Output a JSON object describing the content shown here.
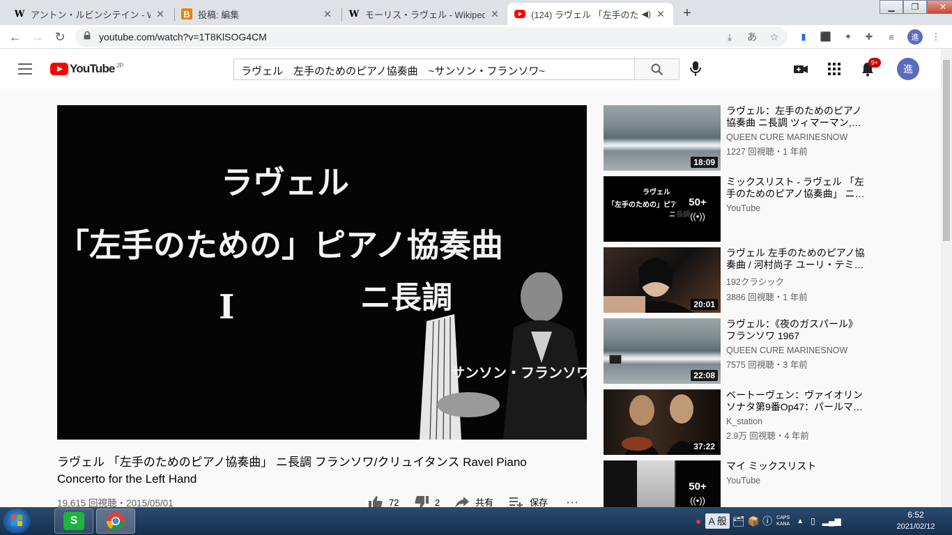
{
  "browser": {
    "tabs": [
      {
        "title": "アントン・ルビンシテイン - Wi",
        "favicon": "W"
      },
      {
        "title": "投稿: 編集",
        "favicon": "B"
      },
      {
        "title": "モーリス・ラヴェル - Wikipedi",
        "favicon": "W"
      },
      {
        "title": "(124) ラヴェル 「左手のた",
        "favicon": "youtube-icon",
        "active": true
      }
    ],
    "url": "youtube.com/watch?v=1T8KlSOG4CM"
  },
  "youtube": {
    "logo_text": "YouTube",
    "region": "JP",
    "search_query": "ラヴェル　左手のためのピアノ協奏曲　~サンソン・フランソワ~",
    "notification_count": "9+",
    "avatar_initial": "進"
  },
  "player_overlay": {
    "line1": "ラヴェル",
    "line2": "「左手のための」ピアノ協奏曲",
    "roman": "I",
    "key": "ニ長調",
    "performer": "サンソン・フランソワ"
  },
  "video": {
    "title": "ラヴェル 「左手のためのピアノ協奏曲」 ニ長調 フランソワ/クリュイタンス Ravel Piano Concerto for the Left Hand",
    "views_date": "19,615 回視聴・2015/05/01",
    "likes": "72",
    "dislikes": "2",
    "share_label": "共有",
    "save_label": "保存"
  },
  "recommendations": [
    {
      "title": "ラヴェル：左手のためのピアノ協奏曲 ニ長調 ツィマーマン,…",
      "channel": "QUEEN CURE MARINESNOW",
      "views": "1227 回視聴・1 年前",
      "duration": "18:09"
    },
    {
      "title": "ミックスリスト - ラヴェル 「左手のためのピアノ協奏曲」 ニ…",
      "channel": "YouTube",
      "views": "",
      "duration": "",
      "mix_count": "50+"
    },
    {
      "title": "ラヴェル 左手のためのピアノ協奏曲 / 河村尚子 ユーリ・テミ…",
      "channel": "192クラシック",
      "views": "3886 回視聴・1 年前",
      "duration": "20:01"
    },
    {
      "title": "ラヴェル：《夜のガスパール》 フランソワ 1967",
      "channel": "QUEEN CURE MARINESNOW",
      "views": "7575 回視聴・3 年前",
      "duration": "22:08"
    },
    {
      "title": "ベートーヴェン：ヴァイオリンソナタ第9番Op47：パールマ…",
      "channel": "K_station",
      "views": "2.9万 回視聴・4 年前",
      "duration": "37:22"
    },
    {
      "title": "マイ ミックスリスト",
      "channel": "YouTube",
      "views": "",
      "duration": "",
      "mix_count": "50+"
    }
  ],
  "thumb_text": {
    "mix_line1": "ラヴェル",
    "mix_line2": "「左手のための」ピア",
    "mix_line3": "ニ長調"
  },
  "taskbar": {
    "ime_label": "A 般",
    "caps_label": "CAPS",
    "kana_label": "KANA",
    "time": "6:52",
    "date": "2021/02/12"
  }
}
